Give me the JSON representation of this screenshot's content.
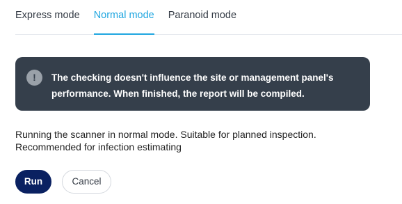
{
  "tabs": [
    {
      "label": "Express mode",
      "active": false
    },
    {
      "label": "Normal mode",
      "active": true
    },
    {
      "label": "Paranoid mode",
      "active": false
    }
  ],
  "alert": {
    "icon": "exclamation-icon",
    "line1": "The checking doesn't influence the site or management panel's",
    "line2": "performance. When finished, the report will be compiled."
  },
  "description": {
    "line1": "Running the scanner in normal mode. Suitable for planned inspection.",
    "line2": "Recommended for infection estimating"
  },
  "buttons": {
    "run": "Run",
    "cancel": "Cancel"
  },
  "colors": {
    "accent": "#1fa6e0",
    "alert_bg": "#353f4b",
    "primary_button": "#0a2161"
  }
}
